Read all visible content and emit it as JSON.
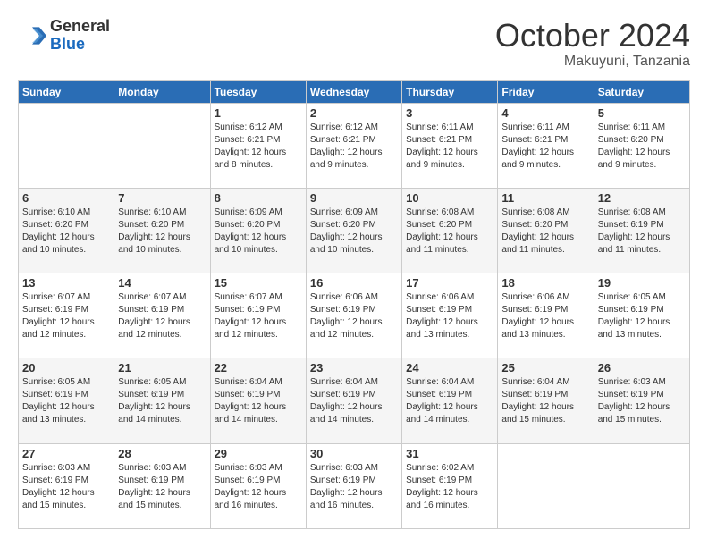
{
  "header": {
    "logo_general": "General",
    "logo_blue": "Blue",
    "month": "October 2024",
    "location": "Makuyuni, Tanzania"
  },
  "days_of_week": [
    "Sunday",
    "Monday",
    "Tuesday",
    "Wednesday",
    "Thursday",
    "Friday",
    "Saturday"
  ],
  "weeks": [
    [
      {
        "day": "",
        "info": ""
      },
      {
        "day": "",
        "info": ""
      },
      {
        "day": "1",
        "info": "Sunrise: 6:12 AM\nSunset: 6:21 PM\nDaylight: 12 hours and 8 minutes."
      },
      {
        "day": "2",
        "info": "Sunrise: 6:12 AM\nSunset: 6:21 PM\nDaylight: 12 hours and 9 minutes."
      },
      {
        "day": "3",
        "info": "Sunrise: 6:11 AM\nSunset: 6:21 PM\nDaylight: 12 hours and 9 minutes."
      },
      {
        "day": "4",
        "info": "Sunrise: 6:11 AM\nSunset: 6:21 PM\nDaylight: 12 hours and 9 minutes."
      },
      {
        "day": "5",
        "info": "Sunrise: 6:11 AM\nSunset: 6:20 PM\nDaylight: 12 hours and 9 minutes."
      }
    ],
    [
      {
        "day": "6",
        "info": "Sunrise: 6:10 AM\nSunset: 6:20 PM\nDaylight: 12 hours and 10 minutes."
      },
      {
        "day": "7",
        "info": "Sunrise: 6:10 AM\nSunset: 6:20 PM\nDaylight: 12 hours and 10 minutes."
      },
      {
        "day": "8",
        "info": "Sunrise: 6:09 AM\nSunset: 6:20 PM\nDaylight: 12 hours and 10 minutes."
      },
      {
        "day": "9",
        "info": "Sunrise: 6:09 AM\nSunset: 6:20 PM\nDaylight: 12 hours and 10 minutes."
      },
      {
        "day": "10",
        "info": "Sunrise: 6:08 AM\nSunset: 6:20 PM\nDaylight: 12 hours and 11 minutes."
      },
      {
        "day": "11",
        "info": "Sunrise: 6:08 AM\nSunset: 6:20 PM\nDaylight: 12 hours and 11 minutes."
      },
      {
        "day": "12",
        "info": "Sunrise: 6:08 AM\nSunset: 6:19 PM\nDaylight: 12 hours and 11 minutes."
      }
    ],
    [
      {
        "day": "13",
        "info": "Sunrise: 6:07 AM\nSunset: 6:19 PM\nDaylight: 12 hours and 12 minutes."
      },
      {
        "day": "14",
        "info": "Sunrise: 6:07 AM\nSunset: 6:19 PM\nDaylight: 12 hours and 12 minutes."
      },
      {
        "day": "15",
        "info": "Sunrise: 6:07 AM\nSunset: 6:19 PM\nDaylight: 12 hours and 12 minutes."
      },
      {
        "day": "16",
        "info": "Sunrise: 6:06 AM\nSunset: 6:19 PM\nDaylight: 12 hours and 12 minutes."
      },
      {
        "day": "17",
        "info": "Sunrise: 6:06 AM\nSunset: 6:19 PM\nDaylight: 12 hours and 13 minutes."
      },
      {
        "day": "18",
        "info": "Sunrise: 6:06 AM\nSunset: 6:19 PM\nDaylight: 12 hours and 13 minutes."
      },
      {
        "day": "19",
        "info": "Sunrise: 6:05 AM\nSunset: 6:19 PM\nDaylight: 12 hours and 13 minutes."
      }
    ],
    [
      {
        "day": "20",
        "info": "Sunrise: 6:05 AM\nSunset: 6:19 PM\nDaylight: 12 hours and 13 minutes."
      },
      {
        "day": "21",
        "info": "Sunrise: 6:05 AM\nSunset: 6:19 PM\nDaylight: 12 hours and 14 minutes."
      },
      {
        "day": "22",
        "info": "Sunrise: 6:04 AM\nSunset: 6:19 PM\nDaylight: 12 hours and 14 minutes."
      },
      {
        "day": "23",
        "info": "Sunrise: 6:04 AM\nSunset: 6:19 PM\nDaylight: 12 hours and 14 minutes."
      },
      {
        "day": "24",
        "info": "Sunrise: 6:04 AM\nSunset: 6:19 PM\nDaylight: 12 hours and 14 minutes."
      },
      {
        "day": "25",
        "info": "Sunrise: 6:04 AM\nSunset: 6:19 PM\nDaylight: 12 hours and 15 minutes."
      },
      {
        "day": "26",
        "info": "Sunrise: 6:03 AM\nSunset: 6:19 PM\nDaylight: 12 hours and 15 minutes."
      }
    ],
    [
      {
        "day": "27",
        "info": "Sunrise: 6:03 AM\nSunset: 6:19 PM\nDaylight: 12 hours and 15 minutes."
      },
      {
        "day": "28",
        "info": "Sunrise: 6:03 AM\nSunset: 6:19 PM\nDaylight: 12 hours and 15 minutes."
      },
      {
        "day": "29",
        "info": "Sunrise: 6:03 AM\nSunset: 6:19 PM\nDaylight: 12 hours and 16 minutes."
      },
      {
        "day": "30",
        "info": "Sunrise: 6:03 AM\nSunset: 6:19 PM\nDaylight: 12 hours and 16 minutes."
      },
      {
        "day": "31",
        "info": "Sunrise: 6:02 AM\nSunset: 6:19 PM\nDaylight: 12 hours and 16 minutes."
      },
      {
        "day": "",
        "info": ""
      },
      {
        "day": "",
        "info": ""
      }
    ]
  ]
}
